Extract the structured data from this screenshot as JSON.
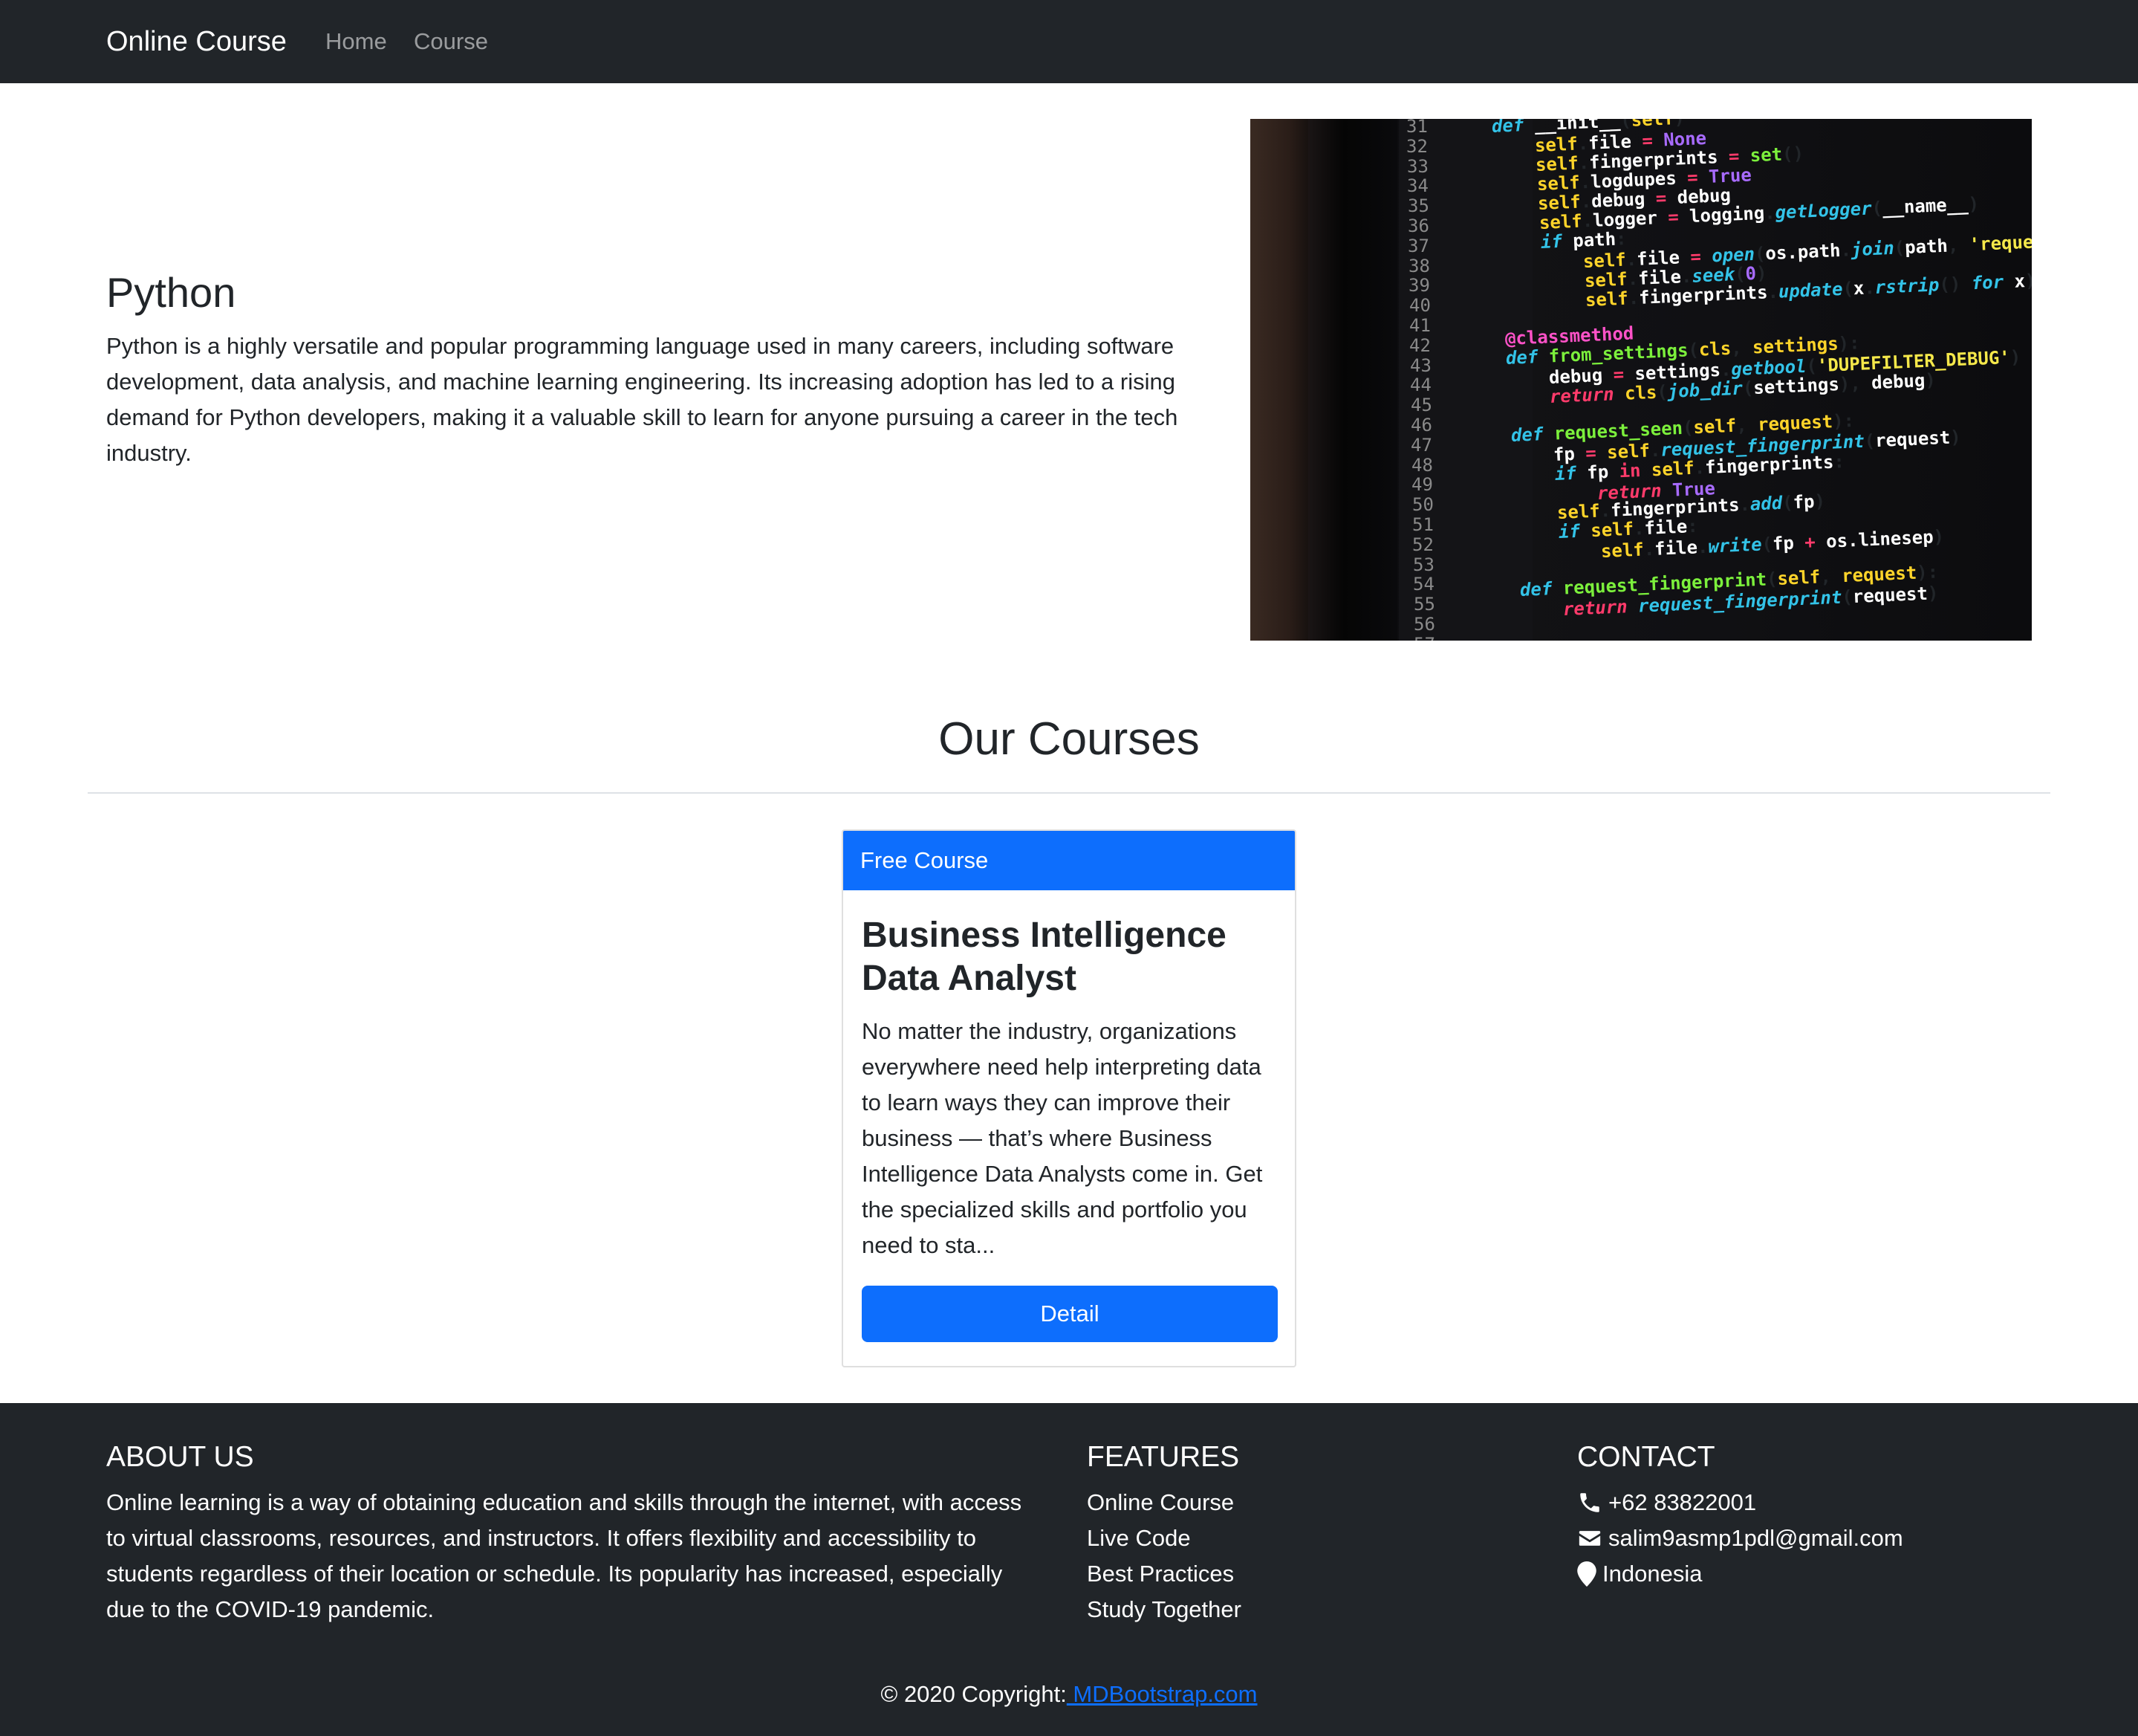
{
  "navbar": {
    "brand": "Online Course",
    "links": [
      "Home",
      "Course"
    ]
  },
  "hero": {
    "title": "Python",
    "text": "Python is a highly versatile and popular programming language used in many careers, including software development, data analysis, and machine learning engineering. Its increasing adoption has led to a rising demand for Python developers, making it a valuable skill to learn for anyone pursuing a career in the tech industry."
  },
  "courses_section": {
    "title": "Our Courses"
  },
  "card": {
    "badge": "Free Course",
    "title": "Business Intelligence Data Analyst",
    "text": "No matter the industry, organizations everywhere need help interpreting data to learn ways they can improve their business — that’s where Business Intelligence Data Analysts come in. Get the specialized skills and portfolio you need to sta...",
    "button": "Detail"
  },
  "footer": {
    "about": {
      "heading": "ABOUT US",
      "text": "Online learning is a way of obtaining education and skills through the internet, with access to virtual classrooms, resources, and instructors. It offers flexibility and accessibility to students regardless of their location or schedule. Its popularity has increased, especially due to the COVID-19 pandemic."
    },
    "features": {
      "heading": "FEATURES",
      "items": [
        "Online Course",
        "Live Code",
        "Best Practices",
        "Study Together"
      ]
    },
    "contact": {
      "heading": "CONTACT",
      "phone": "+62 83822001",
      "email": "salim9asmp1pdl@gmail.com",
      "location": "Indonesia",
      "icons": [
        "phone-icon",
        "envelope-icon",
        "map-marker-icon"
      ]
    },
    "copyright": {
      "text": "© 2020 Copyright:",
      "link": " MDBootstrap.com"
    }
  },
  "colors": {
    "dark": "#212529",
    "primary": "#0d6efd",
    "white": "#ffffff"
  }
}
